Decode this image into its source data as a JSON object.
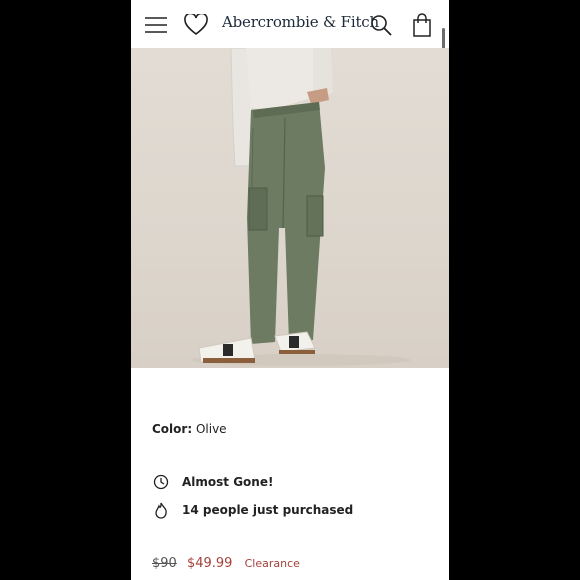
{
  "header": {
    "brand": "Abercrombie & Fitch",
    "icons": [
      "menu-icon",
      "heart-icon",
      "search-icon",
      "bag-icon"
    ]
  },
  "product": {
    "image_alt": "Olive cargo pants",
    "color_label": "Color:",
    "color_value": "Olive",
    "stock_notice": "Almost Gone!",
    "purchase_notice": "14 people just purchased",
    "price_original": "$90",
    "price_sale": "$49.99",
    "price_tag": "Clearance"
  },
  "colors": {
    "brand_text": "#1c2a3a",
    "sale": "#a4413a",
    "pants": "#6c7b62",
    "backdrop": "#e0d9d0"
  }
}
